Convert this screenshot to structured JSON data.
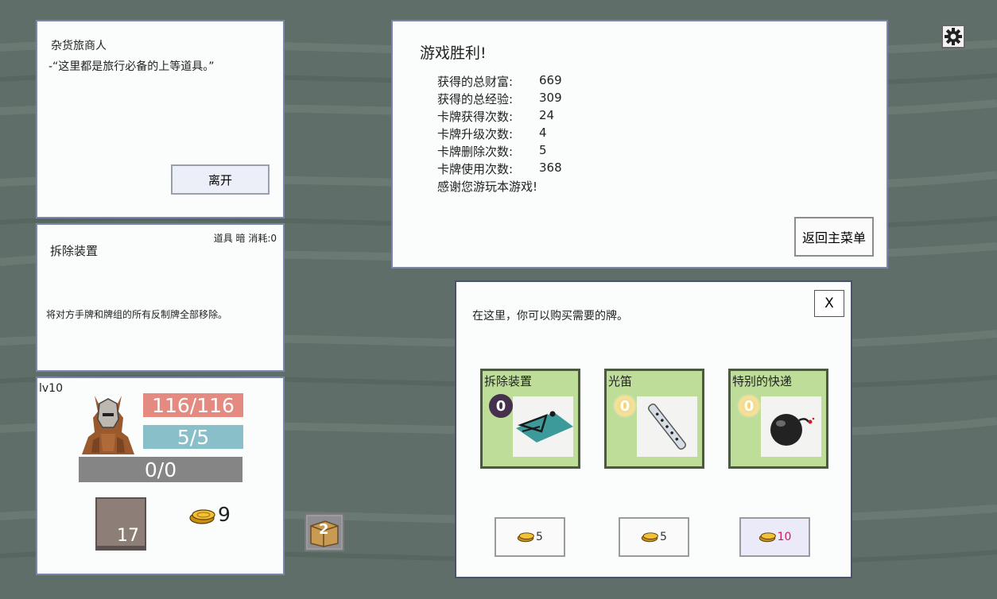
{
  "merchant": {
    "name": "杂货旅商人",
    "quote": "-“这里都是旅行必备的上等道具。”",
    "leave_label": "离开"
  },
  "card_detail": {
    "title": "拆除装置",
    "meta": "道具 暗  消耗:0",
    "description": "将对方手牌和牌组的所有反制牌全部移除。"
  },
  "player": {
    "level": "lv10",
    "hp": "116/116",
    "mp": "5/5",
    "xp": "0/0",
    "deck_count": "17",
    "gold": "9"
  },
  "pile": {
    "count": "2"
  },
  "victory": {
    "title": "游戏胜利!",
    "stats": [
      {
        "label": "获得的总财富:",
        "value": "669"
      },
      {
        "label": "获得的总经验:",
        "value": "309"
      },
      {
        "label": "卡牌获得次数:",
        "value": "24"
      },
      {
        "label": "卡牌升级次数:",
        "value": "4"
      },
      {
        "label": "卡牌删除次数:",
        "value": "5"
      },
      {
        "label": "卡牌使用次数:",
        "value": "368"
      }
    ],
    "thanks": "感谢您游玩本游戏!",
    "return_label": "返回主菜单"
  },
  "shop": {
    "intro": "在这里，你可以购买需要的牌。",
    "close_label": "X",
    "cards": [
      {
        "name": "拆除装置",
        "cost": "0",
        "price": "5",
        "icon": "trap-icon"
      },
      {
        "name": "光笛",
        "cost": "0",
        "price": "5",
        "icon": "flute-icon"
      },
      {
        "name": "特别的快递",
        "cost": "0",
        "price": "10",
        "icon": "bomb-icon"
      }
    ]
  },
  "colors": {
    "background": "#5f6e68",
    "panel_border": "#7b86ad",
    "hp": "#e58a80",
    "mp": "#88bfc8",
    "xp": "#858585",
    "card_bg": "#bddd99",
    "price_highlight": "#d11a5a"
  }
}
